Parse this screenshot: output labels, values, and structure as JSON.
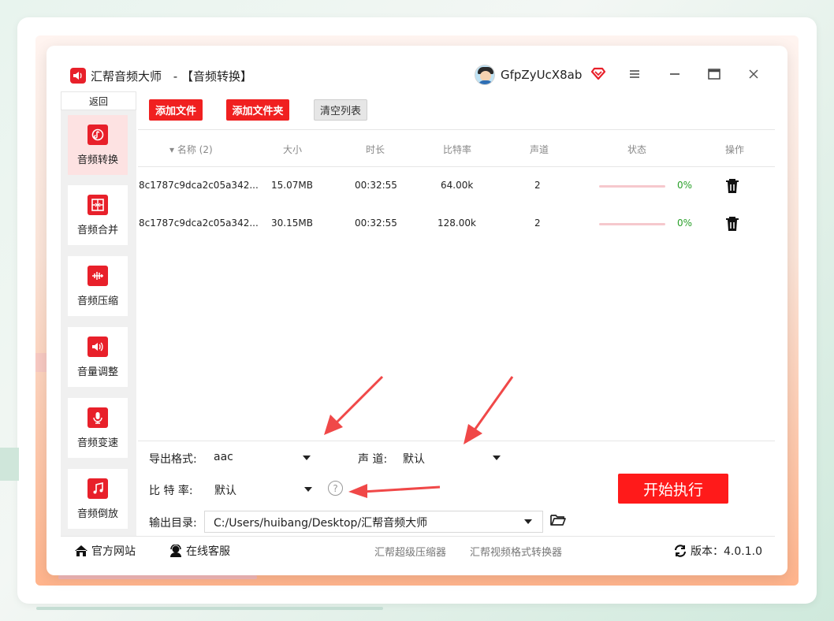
{
  "app": {
    "name": "汇帮音频大师",
    "separator": "-",
    "section": "【音频转换】",
    "username": "GfpZyUcX8ab"
  },
  "sidebar": {
    "back_label": "返回",
    "items": [
      {
        "label": "音频转换",
        "icon": "audio-convert-icon",
        "active": true
      },
      {
        "label": "音频合并",
        "icon": "audio-merge-icon"
      },
      {
        "label": "音频压缩",
        "icon": "audio-compress-icon"
      },
      {
        "label": "音量调整",
        "icon": "volume-adjust-icon"
      },
      {
        "label": "音频变速",
        "icon": "audio-speed-icon"
      },
      {
        "label": "音频倒放",
        "icon": "audio-reverse-icon"
      }
    ]
  },
  "toolbar": {
    "add_file": "添加文件",
    "add_folder": "添加文件夹",
    "clear_list": "清空列表"
  },
  "table": {
    "headers": {
      "name": "▾ 名称 (2)",
      "size": "大小",
      "duration": "时长",
      "bitrate": "比特率",
      "channel": "声道",
      "status": "状态",
      "action": "操作"
    },
    "rows": [
      {
        "name": "8c1787c9dca2c05a342...",
        "size": "15.07MB",
        "duration": "00:32:55",
        "bitrate": "64.00k",
        "channel": "2",
        "progress": 0,
        "percent": "0%"
      },
      {
        "name": "8c1787c9dca2c05a342...",
        "size": "30.15MB",
        "duration": "00:32:55",
        "bitrate": "128.00k",
        "channel": "2",
        "progress": 0,
        "percent": "0%"
      }
    ]
  },
  "settings": {
    "format_label": "导出格式:",
    "format_value": "aac",
    "channel_label": "声 道:",
    "channel_value": "默认",
    "bitrate_label": "比 特 率:",
    "bitrate_value": "默认",
    "help": "?",
    "output_label": "输出目录:",
    "output_path": "C:/Users/huibang/Desktop/汇帮音频大师",
    "start_button": "开始执行"
  },
  "footer": {
    "website": "官方网站",
    "support": "在线客服",
    "link1": "汇帮超级压缩器",
    "link2": "汇帮视频格式转换器",
    "version": "版本：4.0.1.0"
  },
  "colors": {
    "accent": "#f02020",
    "progress_track": "#f6c8cd",
    "percent": "#2aa02a",
    "arrow": "#f04848"
  }
}
